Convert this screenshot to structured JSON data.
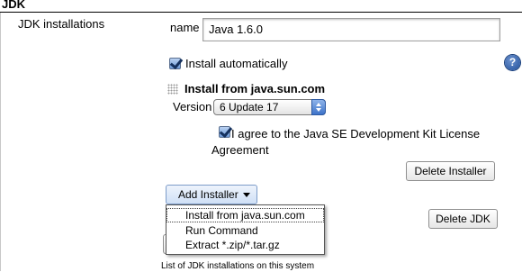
{
  "section": {
    "title": "JDK",
    "field_label": "JDK installations"
  },
  "name_field": {
    "label": "name",
    "value": "Java 1.6.0"
  },
  "install_automatically": {
    "label": "Install automatically",
    "checked": true
  },
  "help": {
    "icon": "help-icon",
    "glyph": "?"
  },
  "installer": {
    "title": "Install from java.sun.com",
    "version_label": "Version",
    "version_value": "6 Update 17",
    "agree_label_line1": "I agree to the Java SE Development Kit License",
    "agree_label_line2": "Agreement",
    "agree_checked": true,
    "delete_installer_label": "Delete Installer"
  },
  "add_installer": {
    "label": "Add Installer",
    "menu_items": [
      "Install from java.sun.com",
      "Run Command",
      "Extract *.zip/*.tar.gz"
    ]
  },
  "delete_jdk_label": "Delete JDK",
  "footnote": "List of JDK installations on this system",
  "colors": {
    "accent_blue": "#3d73c9",
    "help_blue": "#1f4e9a"
  }
}
